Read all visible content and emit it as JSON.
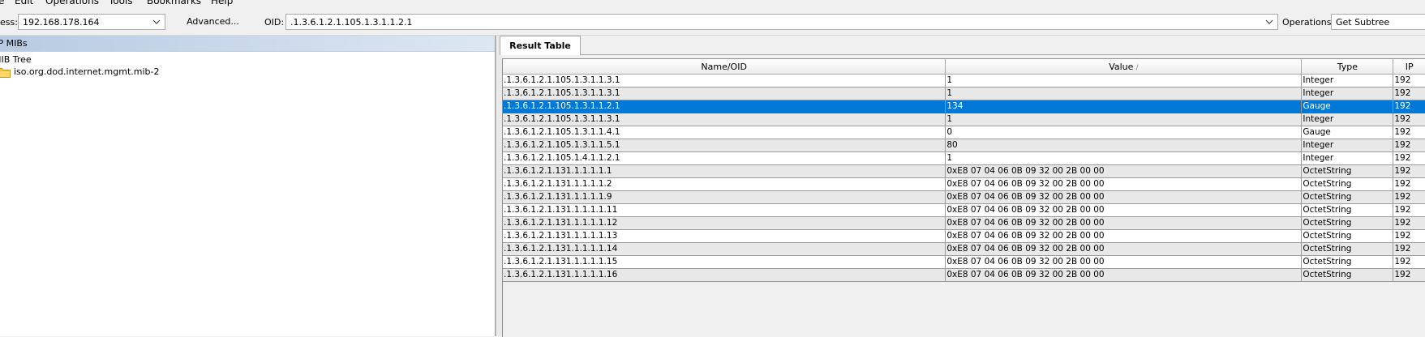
{
  "menu": [
    "e",
    "Edit",
    "Operations",
    "Tools",
    "Bookmarks",
    "Help"
  ],
  "toolbar": {
    "address_label": "ess:",
    "address_value": "192.168.178.164",
    "advanced_label": "Advanced...",
    "oid_label": "OID:",
    "oid_value": ".1.3.6.1.2.1.105.1.3.1.1.2.1",
    "operations_label": "Operations:",
    "operations_value": "Get Subtree"
  },
  "left_panel": {
    "header": "MP MIBs",
    "tree_root": "MIB Tree",
    "tree_item": "iso.org.dod.internet.mgmt.mib-2"
  },
  "tab": {
    "label": "Result Table"
  },
  "table": {
    "columns": [
      "Name/OID",
      "Value",
      "Type",
      "IP"
    ],
    "sort_glyph": "/",
    "rows": [
      {
        "oid": ".1.3.6.1.2.1.105.1.3.1.1.3.1",
        "value": "1",
        "type": "Integer",
        "ip": "192"
      },
      {
        "oid": ".1.3.6.1.2.1.105.1.3.1.1.3.1",
        "value": "1",
        "type": "Integer",
        "ip": "192"
      },
      {
        "oid": ".1.3.6.1.2.1.105.1.3.1.1.2.1",
        "value": "134",
        "type": "Gauge",
        "ip": "192"
      },
      {
        "oid": ".1.3.6.1.2.1.105.1.3.1.1.3.1",
        "value": "1",
        "type": "Integer",
        "ip": "192"
      },
      {
        "oid": ".1.3.6.1.2.1.105.1.3.1.1.4.1",
        "value": "0",
        "type": "Gauge",
        "ip": "192"
      },
      {
        "oid": ".1.3.6.1.2.1.105.1.3.1.1.5.1",
        "value": "80",
        "type": "Integer",
        "ip": "192"
      },
      {
        "oid": ".1.3.6.1.2.1.105.1.4.1.1.2.1",
        "value": "1",
        "type": "Integer",
        "ip": "192"
      },
      {
        "oid": ".1.3.6.1.2.1.131.1.1.1.1.1",
        "value": "0xE8 07 04 06 0B 09 32 00 2B 00 00",
        "type": "OctetString",
        "ip": "192"
      },
      {
        "oid": ".1.3.6.1.2.1.131.1.1.1.1.2",
        "value": "0xE8 07 04 06 0B 09 32 00 2B 00 00",
        "type": "OctetString",
        "ip": "192"
      },
      {
        "oid": ".1.3.6.1.2.1.131.1.1.1.1.9",
        "value": "0xE8 07 04 06 0B 09 32 00 2B 00 00",
        "type": "OctetString",
        "ip": "192"
      },
      {
        "oid": ".1.3.6.1.2.1.131.1.1.1.1.11",
        "value": "0xE8 07 04 06 0B 09 32 00 2B 00 00",
        "type": "OctetString",
        "ip": "192"
      },
      {
        "oid": ".1.3.6.1.2.1.131.1.1.1.1.12",
        "value": "0xE8 07 04 06 0B 09 32 00 2B 00 00",
        "type": "OctetString",
        "ip": "192"
      },
      {
        "oid": ".1.3.6.1.2.1.131.1.1.1.1.13",
        "value": "0xE8 07 04 06 0B 09 32 00 2B 00 00",
        "type": "OctetString",
        "ip": "192"
      },
      {
        "oid": ".1.3.6.1.2.1.131.1.1.1.1.14",
        "value": "0xE8 07 04 06 0B 09 32 00 2B 00 00",
        "type": "OctetString",
        "ip": "192"
      },
      {
        "oid": ".1.3.6.1.2.1.131.1.1.1.1.15",
        "value": "0xE8 07 04 06 0B 09 32 00 2B 00 00",
        "type": "OctetString",
        "ip": "192"
      },
      {
        "oid": ".1.3.6.1.2.1.131.1.1.1.1.16",
        "value": "0xE8 07 04 06 0B 09 32 00 2B 00 00",
        "type": "OctetString",
        "ip": "192"
      }
    ],
    "selected_row": 2
  },
  "colors": {
    "selection": "#0078d7",
    "row_alt": "#e8e8e8",
    "header_gradient_start": "#b8cbe2"
  },
  "icons": [
    "folder-icon",
    "chevron-down-icon"
  ]
}
